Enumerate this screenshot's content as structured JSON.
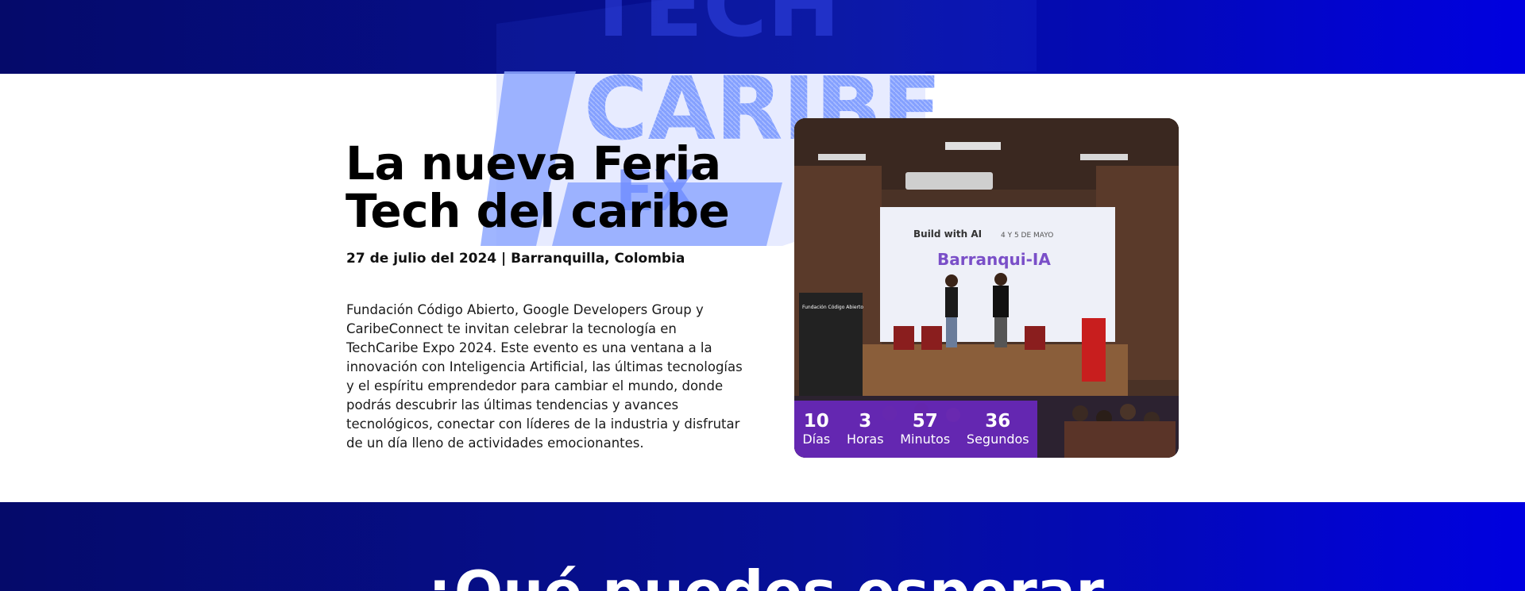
{
  "logo": {
    "word1": "TECH",
    "word2": "CARIBE",
    "word3": "EX"
  },
  "hero": {
    "title_line1": "La nueva Feria",
    "title_line2": "Tech del caribe",
    "subtitle": "27 de julio del 2024 | Barranquilla, Colombia",
    "description": "Fundación Código Abierto, Google Developers Group y CaribeConnect te invitan celebrar la tecnología en TechCaribe Expo 2024. Este evento es una ventana a la innovación con Inteligencia Artificial, las últimas tecnologías y el espíritu emprendedor para cambiar el mundo, donde podrás descubrir las últimas tendencias y avances tecnológicos, conectar con líderes de la industria y disfrutar de un día lleno de actividades emocionantes."
  },
  "photo": {
    "screen_title": "Barranqui-IA",
    "screen_brand": "Build with AI",
    "screen_date": "4 Y 5 DE MAYO",
    "banner_text": "Fundación Código Abierto"
  },
  "countdown": {
    "days_value": "10",
    "days_label": "Días",
    "hours_value": "3",
    "hours_label": "Horas",
    "minutes_value": "57",
    "minutes_label": "Minutos",
    "seconds_value": "36",
    "seconds_label": "Segundos"
  },
  "next_section": {
    "title": "¿Qué puedes esperar"
  },
  "colors": {
    "band_dark": "#050a6a",
    "band_bright": "#0000e0",
    "logo_light": "#8ea8ff",
    "countdown_bg": "#6e28c8"
  }
}
